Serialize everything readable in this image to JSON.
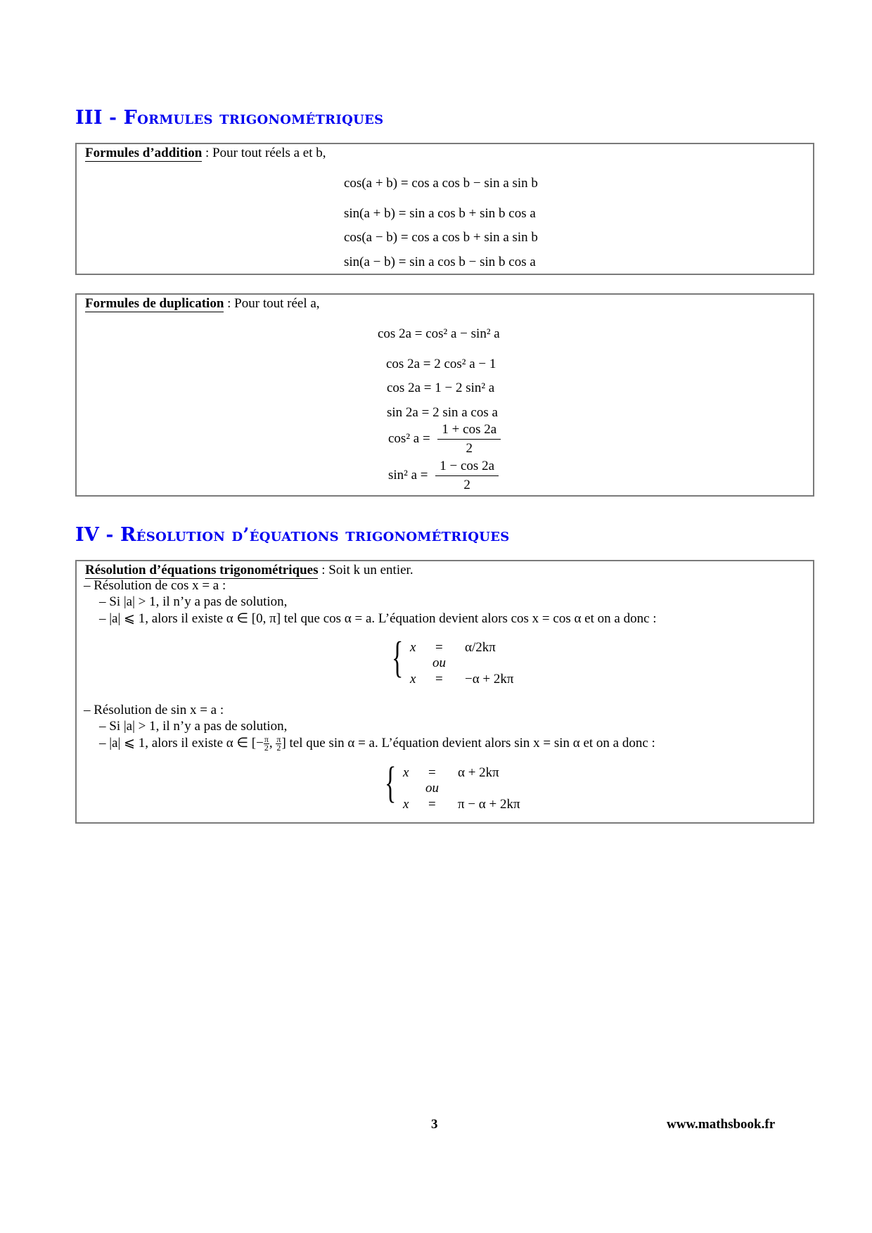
{
  "section3": {
    "number": "III",
    "separator": "-",
    "title_first": "F",
    "title_rest": "ormules trigonométriques",
    "addition_box": {
      "title": "Formules d’addition",
      "intro": " : Pour tout réels a et b,",
      "formulas": [
        "cos(a + b) = cos a cos b − sin a sin b",
        "sin(a + b) = sin a cos b + sin b cos a",
        "cos(a − b) = cos a cos b + sin a sin b",
        "sin(a − b) = sin a cos b − sin b cos a"
      ]
    },
    "duplication_box": {
      "title": "Formules de duplication",
      "intro": " : Pour tout réel a,",
      "formulas": [
        "cos 2a = cos² a − sin² a",
        "cos 2a = 2 cos² a − 1",
        "cos 2a = 1 − 2 sin² a",
        "sin 2a = 2 sin a cos a"
      ],
      "fraction_formulas": [
        {
          "lhs": "cos² a =",
          "numerator": "1 + cos 2a",
          "denominator": "2"
        },
        {
          "lhs": "sin² a =",
          "numerator": "1 − cos 2a",
          "denominator": "2"
        }
      ]
    }
  },
  "section4": {
    "number": "IV",
    "separator": "-",
    "title_first": "R",
    "title_rest": "ésolution d’équations trigonométriques",
    "resolution_box": {
      "title": "Résolution d’équations trigonométriques",
      "intro": " : Soit k un entier.",
      "cos_case": {
        "heading": "– Résolution de cos x = a :",
        "item1": "– Si |a| > 1, il n’y a pas de solution,",
        "item2_pre": "– |a| ⩽ 1, alors il existe α ∈ [0, π] tel que cos α = a. L’équation devient alors cos x = cos α et on a donc :",
        "system": {
          "row1": {
            "lhs": "x",
            "op": "=",
            "rhs": "α/2kπ"
          },
          "or": "ou",
          "row2": {
            "lhs": "x",
            "op": "=",
            "rhs": "−α + 2kπ"
          }
        }
      },
      "sin_case": {
        "heading": "– Résolution de sin x = a :",
        "item1": "– Si |a| > 1, il n’y a pas de solution,",
        "item2_pre": "– |a| ⩽ 1, alors il existe α ∈ [−",
        "item2_frac1_num": "π",
        "item2_frac1_den": "2",
        "item2_sep": ", ",
        "item2_frac2_num": "π",
        "item2_frac2_den": "2",
        "item2_post": "] tel que sin α = a. L’équation devient alors sin x = sin α et on a donc :",
        "system": {
          "row1": {
            "lhs": "x",
            "op": "=",
            "rhs": "α + 2kπ"
          },
          "or": "ou",
          "row2": {
            "lhs": "x",
            "op": "=",
            "rhs": "π − α + 2kπ"
          }
        }
      }
    }
  },
  "footer": {
    "page_number": "3",
    "website": "www.mathsbook.fr"
  },
  "colors": {
    "heading": "#0000f0",
    "box_border": "#7a7a7a"
  }
}
